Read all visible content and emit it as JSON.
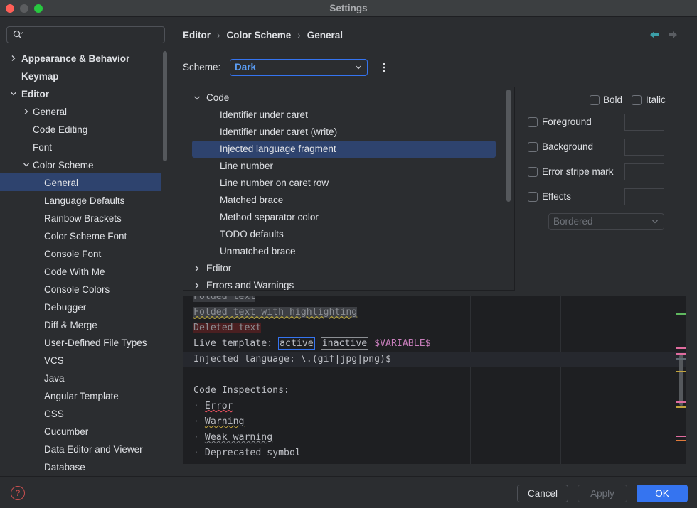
{
  "window": {
    "title": "Settings"
  },
  "sidebar": {
    "search_placeholder": "",
    "items": [
      {
        "label": "Appearance & Behavior",
        "expander": "collapsed"
      },
      {
        "label": "Keymap"
      },
      {
        "label": "Editor",
        "expander": "expanded"
      },
      {
        "label": "General",
        "expander": "collapsed"
      },
      {
        "label": "Code Editing"
      },
      {
        "label": "Font"
      },
      {
        "label": "Color Scheme",
        "expander": "expanded"
      },
      {
        "label": "General",
        "selected": true
      },
      {
        "label": "Language Defaults"
      },
      {
        "label": "Rainbow Brackets"
      },
      {
        "label": "Color Scheme Font"
      },
      {
        "label": "Console Font"
      },
      {
        "label": "Code With Me"
      },
      {
        "label": "Console Colors"
      },
      {
        "label": "Debugger"
      },
      {
        "label": "Diff & Merge"
      },
      {
        "label": "User-Defined File Types"
      },
      {
        "label": "VCS"
      },
      {
        "label": "Java"
      },
      {
        "label": "Angular Template"
      },
      {
        "label": "CSS"
      },
      {
        "label": "Cucumber"
      },
      {
        "label": "Data Editor and Viewer"
      },
      {
        "label": "Database"
      }
    ]
  },
  "breadcrumb": [
    "Editor",
    "Color Scheme",
    "General"
  ],
  "scheme": {
    "label": "Scheme:",
    "value": "Dark"
  },
  "attributes": {
    "items": [
      {
        "label": "Code",
        "expander": "expanded"
      },
      {
        "label": "Identifier under caret"
      },
      {
        "label": "Identifier under caret (write)"
      },
      {
        "label": "Injected language fragment",
        "selected": true
      },
      {
        "label": "Line number"
      },
      {
        "label": "Line number on caret row"
      },
      {
        "label": "Matched brace"
      },
      {
        "label": "Method separator color"
      },
      {
        "label": "TODO defaults"
      },
      {
        "label": "Unmatched brace"
      },
      {
        "label": "Editor",
        "expander": "collapsed"
      },
      {
        "label": "Errors and Warnings",
        "expander": "collapsed"
      }
    ]
  },
  "options": {
    "bold": "Bold",
    "italic": "Italic",
    "foreground": "Foreground",
    "background": "Background",
    "error_stripe": "Error stripe mark",
    "effects": "Effects",
    "effects_type": "Bordered"
  },
  "preview": {
    "folded": "Folded text",
    "folded_hl": "Folded text with highlighting",
    "deleted": "Deleted text",
    "live_template_prefix": "Live template: ",
    "tpl_active": "active",
    "tpl_inactive": "inactive",
    "tpl_var": "$VARIABLE$",
    "injected": "Injected language: \\.(gif|jpg|png)$",
    "inspections_title": "Code Inspections:",
    "error": "Error",
    "warning": "Warning",
    "weak_warning": "Weak warning",
    "deprecated": "Deprecated symbol"
  },
  "footer": {
    "help": "?",
    "cancel": "Cancel",
    "apply": "Apply",
    "ok": "OK"
  },
  "colors": {
    "accent": "#3574f0",
    "selection": "#2e436e",
    "background": "#2b2d30",
    "editor": "#1e1f22"
  }
}
